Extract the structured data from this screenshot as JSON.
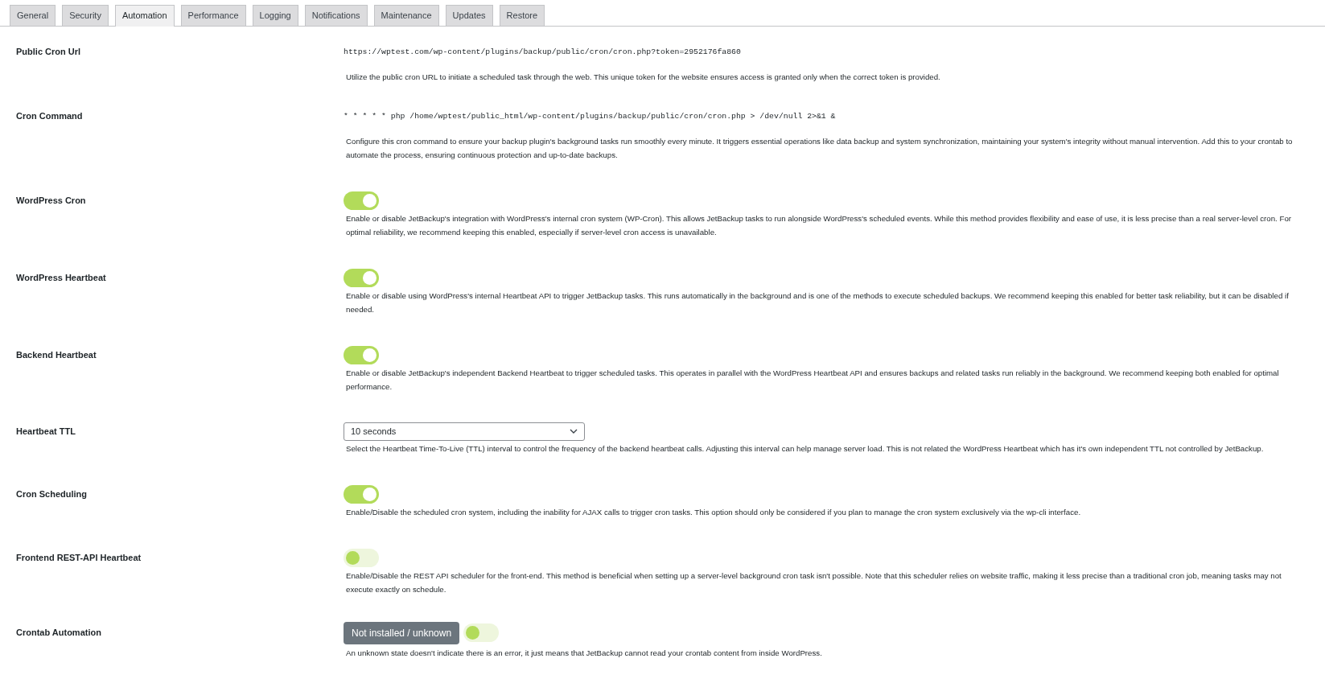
{
  "tabs": [
    {
      "label": "General",
      "selected": false
    },
    {
      "label": "Security",
      "selected": false
    },
    {
      "label": "Automation",
      "selected": true
    },
    {
      "label": "Performance",
      "selected": false
    },
    {
      "label": "Logging",
      "selected": false
    },
    {
      "label": "Notifications",
      "selected": false
    },
    {
      "label": "Maintenance",
      "selected": false
    },
    {
      "label": "Updates",
      "selected": false
    },
    {
      "label": "Restore",
      "selected": false
    }
  ],
  "settings": [
    {
      "label": "Public Cron Url",
      "kind": "code",
      "value": "https://wptest.com/wp-content/plugins/backup/public/cron/cron.php?token=2952176fa860",
      "description": "Utilize the public cron URL to initiate a scheduled task through the web. This unique token for the website ensures access is granted only when the correct token is provided."
    },
    {
      "label": "Cron Command",
      "kind": "code",
      "value": "* * * * * php /home/wptest/public_html/wp-content/plugins/backup/public/cron/cron.php > /dev/null 2>&1 &",
      "description": "Configure this cron command to ensure your backup plugin's background tasks run smoothly every minute. It triggers essential operations like data backup and system synchronization, maintaining your system's integrity without manual intervention. Add this to your crontab to automate the process, ensuring continuous protection and up-to-date backups."
    },
    {
      "label": "WordPress Cron",
      "kind": "toggle",
      "on": true,
      "description": "Enable or disable JetBackup's integration with WordPress's internal cron system (WP-Cron). This allows JetBackup tasks to run alongside WordPress's scheduled events. While this method provides flexibility and ease of use, it is less precise than a real server-level cron. For optimal reliability, we recommend keeping this enabled, especially if server-level cron access is unavailable."
    },
    {
      "label": "WordPress Heartbeat",
      "kind": "toggle",
      "on": true,
      "description": "Enable or disable using WordPress's internal Heartbeat API to trigger JetBackup tasks. This runs automatically in the background and is one of the methods to execute scheduled backups. We recommend keeping this enabled for better task reliability, but it can be disabled if needed."
    },
    {
      "label": "Backend Heartbeat",
      "kind": "toggle",
      "on": true,
      "description": "Enable or disable JetBackup's independent Backend Heartbeat to trigger scheduled tasks. This operates in parallel with the WordPress Heartbeat API and ensures backups and related tasks run reliably in the background. We recommend keeping both enabled for optimal performance."
    },
    {
      "label": "Heartbeat TTL",
      "kind": "select",
      "value": "10 seconds",
      "description": "Select the Heartbeat Time-To-Live (TTL) interval to control the frequency of the backend heartbeat calls. Adjusting this interval can help manage server load. This is not related the WordPress Heartbeat which has it's own independent TTL not controlled by JetBackup."
    },
    {
      "label": "Cron Scheduling",
      "kind": "toggle",
      "on": true,
      "description": "Enable/Disable the scheduled cron system, including the inability for AJAX calls to trigger cron tasks. This option should only be considered if you plan to manage the cron system exclusively via the wp-cli interface."
    },
    {
      "label": "Frontend REST-API Heartbeat",
      "kind": "toggle",
      "on": false,
      "description": "Enable/Disable the REST API scheduler for the front-end. This method is beneficial when setting up a server-level background cron task isn't possible. Note that this scheduler relies on website traffic, making it less precise than a traditional cron job, meaning tasks may not execute exactly on schedule."
    },
    {
      "label": "Crontab Automation",
      "kind": "status_toggle",
      "status": "Not installed / unknown",
      "on": false,
      "description": "An unknown state doesn't indicate there is an error, it just means that JetBackup cannot read your crontab content from inside WordPress."
    }
  ]
}
